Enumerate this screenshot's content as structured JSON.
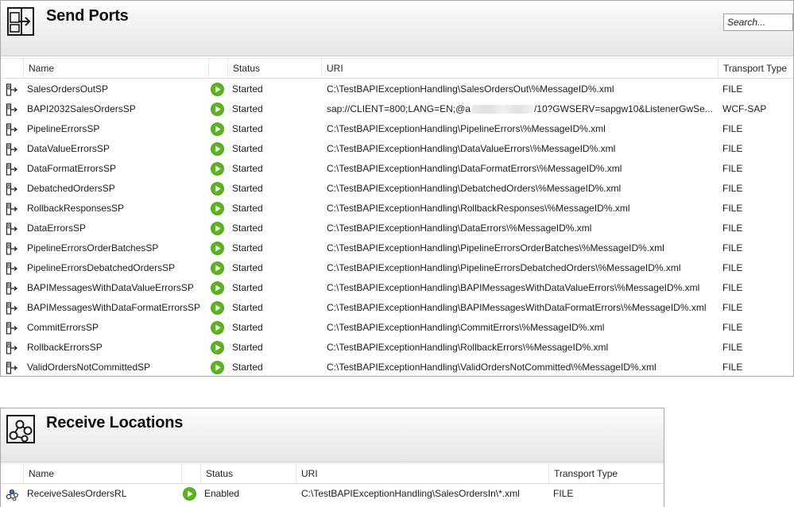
{
  "send_ports": {
    "title": "Send Ports",
    "search_placeholder": "Search...",
    "columns": [
      "Name",
      "Status",
      "URI",
      "Transport Type"
    ],
    "rows": [
      {
        "name": "SalesOrdersOutSP",
        "status": "Started",
        "uri": "C:\\TestBAPIExceptionHandling\\SalesOrdersOut\\%MessageID%.xml",
        "transport": "FILE"
      },
      {
        "name": "BAPI2032SalesOrdersSP",
        "status": "Started",
        "uri": "sap://CLIENT=800;LANG=EN;@a",
        "uri_tail": "/10?GWSERV=sapgw10&ListenerGwSe...",
        "transport": "WCF-SAP"
      },
      {
        "name": "PipelineErrorsSP",
        "status": "Started",
        "uri": "C:\\TestBAPIExceptionHandling\\PipelineErrors\\%MessageID%.xml",
        "transport": "FILE"
      },
      {
        "name": "DataValueErrorsSP",
        "status": "Started",
        "uri": "C:\\TestBAPIExceptionHandling\\DataValueErrors\\%MessageID%.xml",
        "transport": "FILE"
      },
      {
        "name": "DataFormatErrorsSP",
        "status": "Started",
        "uri": "C:\\TestBAPIExceptionHandling\\DataFormatErrors\\%MessageID%.xml",
        "transport": "FILE"
      },
      {
        "name": "DebatchedOrdersSP",
        "status": "Started",
        "uri": "C:\\TestBAPIExceptionHandling\\DebatchedOrders\\%MessageID%.xml",
        "transport": "FILE"
      },
      {
        "name": "RollbackResponsesSP",
        "status": "Started",
        "uri": "C:\\TestBAPIExceptionHandling\\RollbackResponses\\%MessageID%.xml",
        "transport": "FILE"
      },
      {
        "name": "DataErrorsSP",
        "status": "Started",
        "uri": "C:\\TestBAPIExceptionHandling\\DataErrors\\%MessageID%.xml",
        "transport": "FILE"
      },
      {
        "name": "PipelineErrorsOrderBatchesSP",
        "status": "Started",
        "uri": "C:\\TestBAPIExceptionHandling\\PipelineErrorsOrderBatches\\%MessageID%.xml",
        "transport": "FILE"
      },
      {
        "name": "PipelineErrorsDebatchedOrdersSP",
        "status": "Started",
        "uri": "C:\\TestBAPIExceptionHandling\\PipelineErrorsDebatchedOrders\\%MessageID%.xml",
        "transport": "FILE"
      },
      {
        "name": "BAPIMessagesWithDataValueErrorsSP",
        "status": "Started",
        "uri": "C:\\TestBAPIExceptionHandling\\BAPIMessagesWithDataValueErrors\\%MessageID%.xml",
        "transport": "FILE"
      },
      {
        "name": "BAPIMessagesWithDataFormatErrorsSP",
        "status": "Started",
        "uri": "C:\\TestBAPIExceptionHandling\\BAPIMessagesWithDataFormatErrors\\%MessageID%.xml",
        "transport": "FILE"
      },
      {
        "name": "CommitErrorsSP",
        "status": "Started",
        "uri": "C:\\TestBAPIExceptionHandling\\CommitErrors\\%MessageID%.xml",
        "transport": "FILE"
      },
      {
        "name": "RollbackErrorsSP",
        "status": "Started",
        "uri": "C:\\TestBAPIExceptionHandling\\RollbackErrors\\%MessageID%.xml",
        "transport": "FILE"
      },
      {
        "name": "ValidOrdersNotCommittedSP",
        "status": "Started",
        "uri": "C:\\TestBAPIExceptionHandling\\ValidOrdersNotCommitted\\%MessageID%.xml",
        "transport": "FILE"
      }
    ]
  },
  "receive_locations": {
    "title": "Receive Locations",
    "columns": [
      "Name",
      "Status",
      "URI",
      "Transport Type"
    ],
    "rows": [
      {
        "name": "ReceiveSalesOrdersRL",
        "status": "Enabled",
        "uri": "C:\\TestBAPIExceptionHandling\\SalesOrdersIn\\*.xml",
        "transport": "FILE"
      }
    ]
  },
  "colors": {
    "status_green": "#5db51e",
    "header_gradient_end": "#e6e6e6",
    "border": "#a8a8a8"
  },
  "icons": {
    "send_port_panel": "send-port-icon",
    "receive_panel": "receive-location-icon",
    "row_send_port": "send-port-row-icon",
    "row_receive": "receive-location-row-icon",
    "status": "play-icon"
  }
}
